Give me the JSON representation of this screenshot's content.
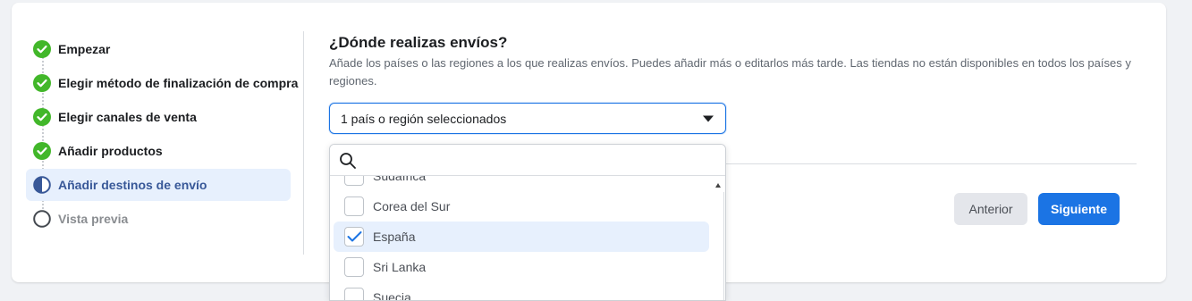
{
  "steps": [
    {
      "label": "Empezar",
      "status": "done"
    },
    {
      "label": "Elegir método de finalización de compra",
      "status": "done"
    },
    {
      "label": "Elegir canales de venta",
      "status": "done"
    },
    {
      "label": "Añadir productos",
      "status": "done"
    },
    {
      "label": "Añadir destinos de envío",
      "status": "current"
    },
    {
      "label": "Vista previa",
      "status": "pending"
    }
  ],
  "main": {
    "title": "¿Dónde realizas envíos?",
    "description": "Añade los países o las regiones a los que realizas envíos. Puedes añadir más o editarlos más tarde. Las tiendas no están disponibles en todos los países y regiones."
  },
  "select": {
    "value": "1 país o región seleccionados"
  },
  "dropdown": {
    "search_placeholder": "",
    "options": [
      {
        "label": "Sudáfrica",
        "checked": false
      },
      {
        "label": "Corea del Sur",
        "checked": false
      },
      {
        "label": "España",
        "checked": true
      },
      {
        "label": "Sri Lanka",
        "checked": false
      },
      {
        "label": "Suecia",
        "checked": false
      }
    ]
  },
  "buttons": {
    "previous": "Anterior",
    "next": "Siguiente"
  },
  "colors": {
    "accent": "#1b74e4",
    "done": "#42b72a",
    "active_bg": "#e7f0fd"
  }
}
